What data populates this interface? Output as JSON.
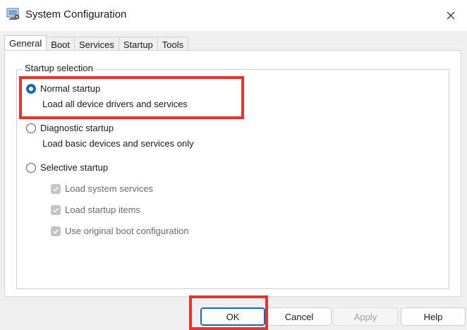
{
  "window": {
    "title": "System Configuration"
  },
  "tabs": [
    {
      "label": "General",
      "active": true
    },
    {
      "label": "Boot",
      "active": false
    },
    {
      "label": "Services",
      "active": false
    },
    {
      "label": "Startup",
      "active": false
    },
    {
      "label": "Tools",
      "active": false
    }
  ],
  "startup_selection": {
    "legend": "Startup selection",
    "normal": {
      "label": "Normal startup",
      "description": "Load all device drivers and services",
      "selected": true
    },
    "diagnostic": {
      "label": "Diagnostic startup",
      "description": "Load basic devices and services only",
      "selected": false
    },
    "selective": {
      "label": "Selective startup",
      "selected": false
    },
    "options": [
      {
        "label": "Load system services",
        "checked": true,
        "enabled": false
      },
      {
        "label": "Load startup items",
        "checked": true,
        "enabled": false
      },
      {
        "label": "Use original boot configuration",
        "checked": true,
        "enabled": false
      }
    ]
  },
  "buttons": {
    "ok": "OK",
    "cancel": "Cancel",
    "apply": "Apply",
    "help": "Help"
  },
  "colors": {
    "accent": "#0f6cbd",
    "highlight": "#e8332a"
  },
  "icons": {
    "app": "msconfig-icon",
    "close": "close-icon",
    "check": "checkmark-icon"
  }
}
